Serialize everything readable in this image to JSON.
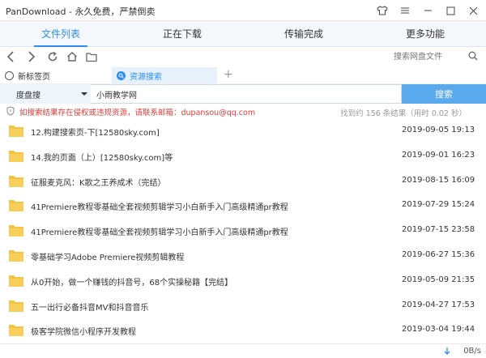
{
  "window": {
    "title": "PanDownload - 永久免费，严禁倒卖",
    "skin_icon": "shirt-icon",
    "menu_icon": "menu-icon",
    "min_icon": "minimize-icon",
    "max_icon": "maximize-icon",
    "close_icon": "close-icon"
  },
  "tabs": [
    {
      "label": "文件列表",
      "active": true
    },
    {
      "label": "正在下载",
      "active": false
    },
    {
      "label": "传输完成",
      "active": false
    },
    {
      "label": "更多功能",
      "active": false
    }
  ],
  "toolbar": {
    "search_placeholder": "搜索网盘文件"
  },
  "browser_tabs": {
    "new_tab": "新标签页",
    "search_tab": "资源搜索",
    "add": "+"
  },
  "searchbar": {
    "engine": "度盘搜",
    "keyword": "小雨教学网",
    "button": "搜索"
  },
  "notice": {
    "warning": "如搜索结果存在侵权或违规资源，请联系邮箱：dupansou@qq.com",
    "count": "找到约 156 条结果（用时 0.02 秒）"
  },
  "results": [
    {
      "name": "12.构建搜索页-下[12580sky.com]",
      "date": "2019-09-05 19:13"
    },
    {
      "name": "14.我的页面（上）[12580sky.com]等",
      "date": "2019-09-01 16:23"
    },
    {
      "name": "征服麦克风：K歌之王养成术（完结）",
      "date": "2019-08-15 16:09"
    },
    {
      "name": "41Premiere教程零基础全套视频剪辑学习小白新手入门高级精通pr教程",
      "date": "2019-07-29 15:24"
    },
    {
      "name": "41Premiere教程零基础全套视频剪辑学习小白新手入门高级精通pr教程",
      "date": "2019-07-15 23:58"
    },
    {
      "name": "零基础学习Adobe Premiere视频剪辑教程",
      "date": "2019-06-27 15:36"
    },
    {
      "name": "从0开始，做一个赚钱的抖音号，68个实操秘籍【完结】",
      "date": "2019-05-09 21:35"
    },
    {
      "name": "五一出行必备抖音MV和抖音音乐",
      "date": "2019-04-27 17:53"
    },
    {
      "name": "极客学院微信小程序开发教程",
      "date": "2019-03-04 19:44"
    }
  ],
  "status": {
    "speed": "0B/s"
  },
  "colors": {
    "accent": "#2d8cf0",
    "warning": "#e33b3b",
    "folder": "#f5c342",
    "search_button": "#5aa9ec"
  }
}
